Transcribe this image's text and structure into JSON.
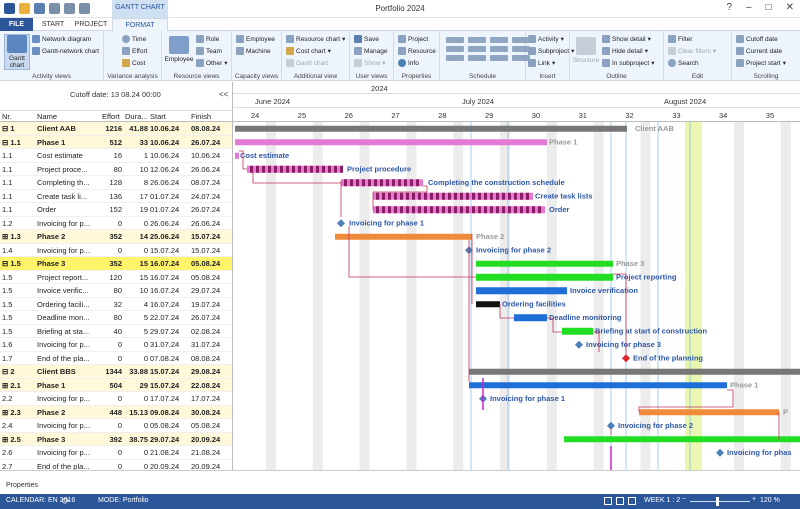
{
  "app": {
    "title": "Portfolio 2024"
  },
  "colors": {
    "accent": "#2b579a",
    "ribbon_bg": "#eef4fb",
    "group_row": "#fff8d9",
    "selected_row": "#fff36a",
    "phase_bar": "#e27ad6",
    "summary_bar": "#777777",
    "blue_bar": "#1e6fd8",
    "orange_bar": "#ee8a3a",
    "green_bar": "#22dd22",
    "milestone": "#4a7fb8",
    "link_line": "#c0365a",
    "today_col": "#eaf7b0"
  },
  "tabs": {
    "contextual": "GANTT CHART",
    "file": "FILE",
    "start": "START",
    "project": "PROJECT",
    "format": "FORMAT"
  },
  "ribbon": {
    "activity_views": {
      "label": "Activity views",
      "gantt": "Gantt chart",
      "network": "Network diagram",
      "gantt_network": "Gantt-network chart"
    },
    "variance": {
      "label": "Variance analysis",
      "time": "Time",
      "effort": "Effort",
      "cost": "Cost"
    },
    "resource_views": {
      "label": "Resource views",
      "employee": "Employee",
      "role": "Role",
      "team": "Team",
      "other": "Other"
    },
    "capacity_views": {
      "label": "Capacity views",
      "employee": "Employee",
      "machine": "Machine"
    },
    "additional_view": {
      "label": "Additional view",
      "resource_chart": "Resource chart",
      "cost_chart": "Cost chart",
      "gantt_chart": "Gantt chart"
    },
    "user_views": {
      "label": "User views",
      "save": "Save",
      "manage": "Manage",
      "show": "Show"
    },
    "properties": {
      "label": "Properties",
      "project": "Project",
      "resource": "Resource",
      "info": "Info"
    },
    "schedule": {
      "label": "Schedule"
    },
    "insert": {
      "label": "Insert",
      "activity": "Activity",
      "subproject": "Subproject",
      "link": "Link"
    },
    "outline": {
      "label": "Outline",
      "structure": "Structure",
      "show_detail": "Show detail",
      "hide_detail": "Hide detail",
      "in_subproject": "In subproject"
    },
    "edit": {
      "label": "Edit",
      "filter": "Filter",
      "clear_filters": "Clear filters",
      "search": "Search"
    },
    "scrolling": {
      "label": "Scrolling",
      "cutoff_date": "Cutoff date",
      "current_date": "Current date",
      "project_start": "Project start"
    }
  },
  "table": {
    "cutoff": "Cutoff date: 13 08.24 00:00",
    "collapse": "<<",
    "headers": {
      "nr": "Nr.",
      "name": "Name",
      "effort": "Effort",
      "duration": "Dura...",
      "start": "Start",
      "finish": "Finish"
    },
    "rows": [
      {
        "nr": "⊟ 1",
        "name": "Client AAB",
        "effort": "1216",
        "dur": "41.88",
        "start": "10.06.24",
        "finish": "08.08.24",
        "style": "grp1"
      },
      {
        "nr": "  ⊟ 1.1",
        "name": "Phase 1",
        "effort": "512",
        "dur": "33",
        "start": "10.06.24",
        "finish": "26.07.24",
        "style": "phase"
      },
      {
        "nr": "1.1",
        "name": "Cost estimate",
        "effort": "16",
        "dur": "1",
        "start": "10.06.24",
        "finish": "10.06.24",
        "style": ""
      },
      {
        "nr": "1.1",
        "name": "Project proce...",
        "effort": "80",
        "dur": "10",
        "start": "12.06.24",
        "finish": "26.06.24",
        "style": ""
      },
      {
        "nr": "1.1",
        "name": "Completing th...",
        "effort": "128",
        "dur": "8",
        "start": "26.06.24",
        "finish": "08.07.24",
        "style": ""
      },
      {
        "nr": "1.1",
        "name": "Create task li...",
        "effort": "136",
        "dur": "17",
        "start": "01.07.24",
        "finish": "24.07.24",
        "style": ""
      },
      {
        "nr": "1.1",
        "name": "Order",
        "effort": "152",
        "dur": "19",
        "start": "01.07.24",
        "finish": "26.07.24",
        "style": ""
      },
      {
        "nr": "1.2",
        "name": "Invoicing for p...",
        "effort": "0",
        "dur": "0",
        "start": "26.06.24",
        "finish": "26.06.24",
        "style": ""
      },
      {
        "nr": "  ⊞ 1.3",
        "name": "Phase 2",
        "effort": "352",
        "dur": "14",
        "start": "25.06.24",
        "finish": "15.07.24",
        "style": "phase"
      },
      {
        "nr": "1.4",
        "name": "Invoicing for p...",
        "effort": "0",
        "dur": "0",
        "start": "15.07.24",
        "finish": "15.07.24",
        "style": ""
      },
      {
        "nr": "  ⊟ 1.5",
        "name": "Phase 3",
        "effort": "352",
        "dur": "15",
        "start": "16.07.24",
        "finish": "05.08.24",
        "style": "sel"
      },
      {
        "nr": "1.5",
        "name": "Project report...",
        "effort": "120",
        "dur": "15",
        "start": "16.07.24",
        "finish": "05.08.24",
        "style": ""
      },
      {
        "nr": "1.5",
        "name": "Invoice verific...",
        "effort": "80",
        "dur": "10",
        "start": "16.07.24",
        "finish": "29.07.24",
        "style": ""
      },
      {
        "nr": "1.5",
        "name": "Ordering facili...",
        "effort": "32",
        "dur": "4",
        "start": "16.07.24",
        "finish": "19.07.24",
        "style": ""
      },
      {
        "nr": "1.5",
        "name": "Deadline mon...",
        "effort": "80",
        "dur": "5",
        "start": "22.07.24",
        "finish": "26.07.24",
        "style": ""
      },
      {
        "nr": "1.5",
        "name": "Briefing at sta...",
        "effort": "40",
        "dur": "5",
        "start": "29.07.24",
        "finish": "02.08.24",
        "style": ""
      },
      {
        "nr": "1.6",
        "name": "Invoicing for p...",
        "effort": "0",
        "dur": "0",
        "start": "31.07.24",
        "finish": "31.07.24",
        "style": ""
      },
      {
        "nr": "1.7",
        "name": "End of the pla...",
        "effort": "0",
        "dur": "0",
        "start": "07.08.24",
        "finish": "08.08.24",
        "style": ""
      },
      {
        "nr": "⊟ 2",
        "name": "Client BBS",
        "effort": "1344",
        "dur": "33.88",
        "start": "15.07.24",
        "finish": "29.08.24",
        "style": "grp1"
      },
      {
        "nr": "  ⊞ 2.1",
        "name": "Phase 1",
        "effort": "504",
        "dur": "29",
        "start": "15.07.24",
        "finish": "22.08.24",
        "style": "phase"
      },
      {
        "nr": "2.2",
        "name": "Invoicing for p...",
        "effort": "0",
        "dur": "0",
        "start": "17.07.24",
        "finish": "17.07.24",
        "style": ""
      },
      {
        "nr": "  ⊞ 2.3",
        "name": "Phase 2",
        "effort": "448",
        "dur": "15.13",
        "start": "09.08.24",
        "finish": "30.08.24",
        "style": "phase"
      },
      {
        "nr": "2.4",
        "name": "Invoicing for p...",
        "effort": "0",
        "dur": "0",
        "start": "05.08.24",
        "finish": "05.08.24",
        "style": ""
      },
      {
        "nr": "  ⊞ 2.5",
        "name": "Phase 3",
        "effort": "392",
        "dur": "38.75",
        "start": "29.07.24",
        "finish": "20.09.24",
        "style": "phase"
      },
      {
        "nr": "2.6",
        "name": "Invoicing for p...",
        "effort": "0",
        "dur": "0",
        "start": "21.08.24",
        "finish": "21.08.24",
        "style": ""
      },
      {
        "nr": "2.7",
        "name": "End of the pla...",
        "effort": "0",
        "dur": "0",
        "start": "20.09.24",
        "finish": "20.09.24",
        "style": ""
      }
    ]
  },
  "gantt": {
    "year": "2024",
    "months": [
      "June 2024",
      "July 2024",
      "August 2024"
    ],
    "weeks": [
      "24",
      "25",
      "26",
      "27",
      "28",
      "29",
      "30",
      "31",
      "32",
      "33",
      "34",
      "35"
    ],
    "labels": {
      "client_aab": "Client AAB",
      "phase1": "Phase 1",
      "cost_estimate": "Cost estimate",
      "project_procedure": "Project procedure",
      "completing": "Completing the construction schedule",
      "task_lists": "Create task lists",
      "order": "Order",
      "inv1": "Invoicing for phase 1",
      "phase2": "Phase 2",
      "inv2": "Invoicing for phase 2",
      "phase3": "Phase 3",
      "reporting": "Project reporting",
      "inv_verif": "Invoice verification",
      "ordering": "Ordering facilities",
      "deadline": "Deadline monitoring",
      "briefing": "Briefing at start of construction",
      "inv3": "Invoicing for phase 3",
      "end_planning": "End of the planning",
      "b_phase1": "Phase 1",
      "b_inv1": "Invoicing for phase 1",
      "b_p": "P",
      "b_inv2": "Invoicing for phase 2",
      "b_inv3": "Invoicing for phas"
    }
  },
  "bottom": {
    "properties": "Properties",
    "calendar": "CALENDAR: EN 2016",
    "mode": "MODE: Portfolio",
    "week": "WEEK 1 : 2",
    "zoom": "120 %"
  }
}
